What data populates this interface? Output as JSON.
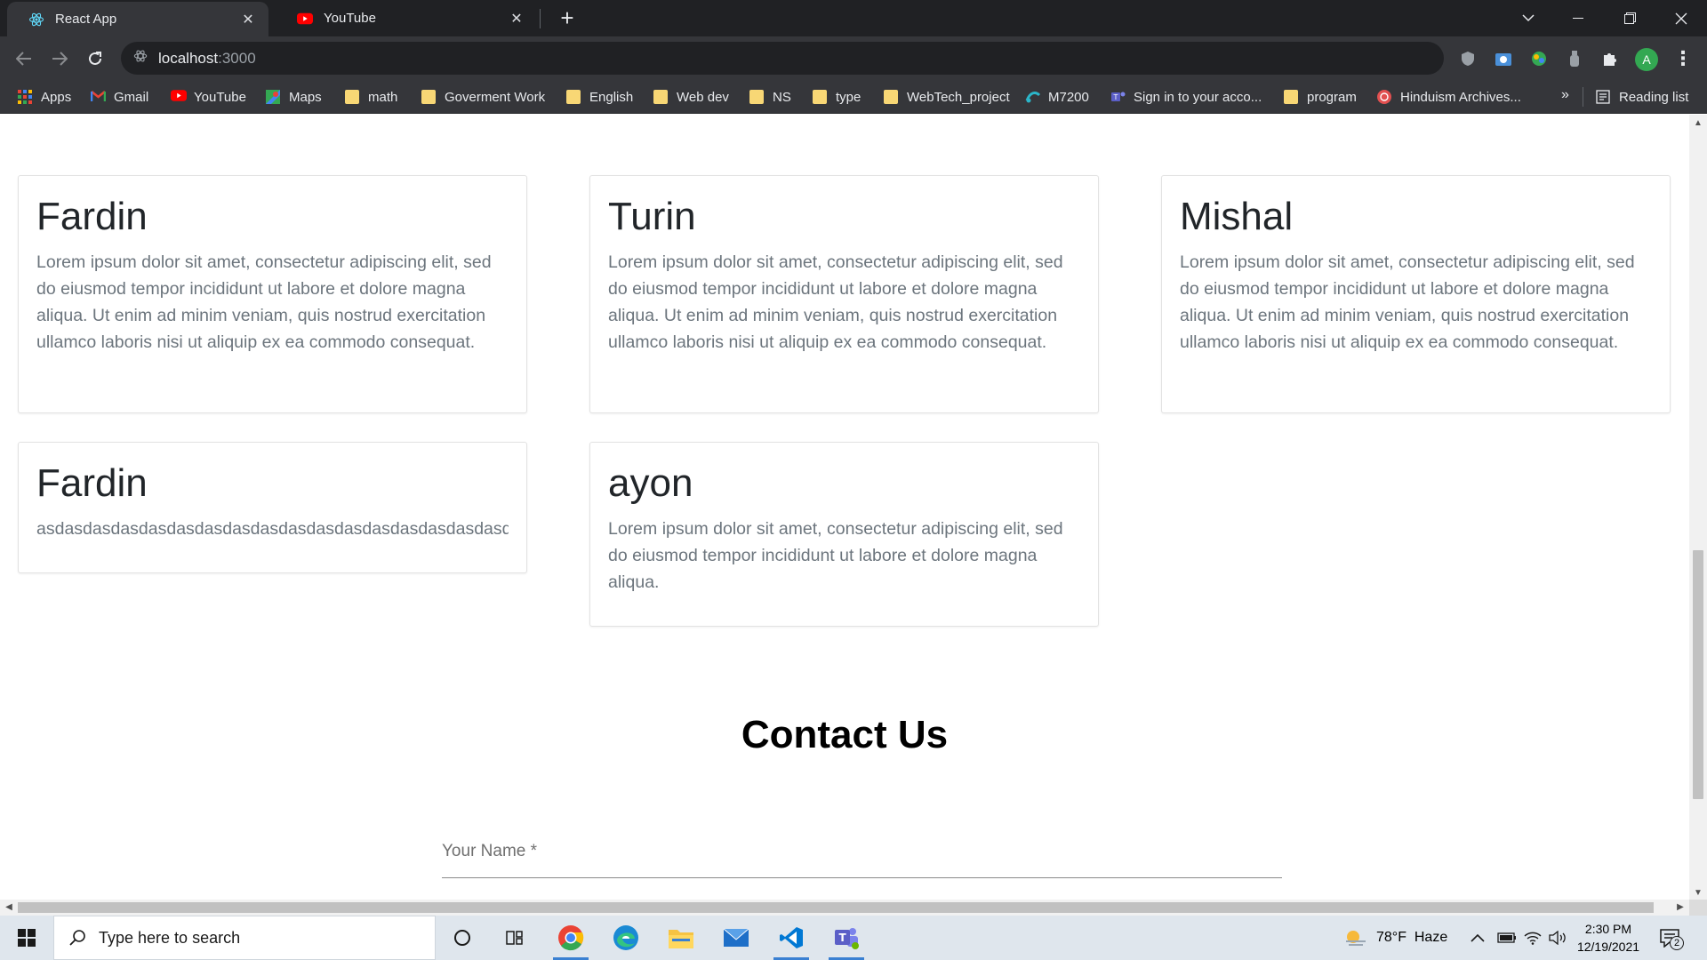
{
  "browser": {
    "tabs": [
      {
        "title": "React App",
        "active": true
      },
      {
        "title": "YouTube",
        "active": false
      }
    ],
    "url_host": "localhost",
    "url_port": ":3000",
    "profile_initial": "A"
  },
  "bookmarks": {
    "items": [
      {
        "label": "Apps",
        "icon": "apps-grid-icon"
      },
      {
        "label": "Gmail",
        "icon": "gmail-icon"
      },
      {
        "label": "YouTube",
        "icon": "youtube-icon"
      },
      {
        "label": "Maps",
        "icon": "maps-icon"
      },
      {
        "label": "math",
        "icon": "folder-icon"
      },
      {
        "label": "Goverment Work",
        "icon": "folder-icon"
      },
      {
        "label": "English",
        "icon": "folder-icon"
      },
      {
        "label": "Web dev",
        "icon": "folder-icon"
      },
      {
        "label": "NS",
        "icon": "folder-icon"
      },
      {
        "label": "type",
        "icon": "folder-icon"
      },
      {
        "label": "WebTech_project",
        "icon": "folder-icon"
      },
      {
        "label": "M7200",
        "icon": "m7200-icon"
      },
      {
        "label": "Sign in to your acco...",
        "icon": "teams-icon"
      },
      {
        "label": "program",
        "icon": "folder-icon"
      },
      {
        "label": "Hinduism Archives...",
        "icon": "hinduism-icon"
      }
    ],
    "more": "»",
    "reading_list": "Reading list"
  },
  "page": {
    "cards": [
      {
        "name": "Fardin",
        "text": "Lorem ipsum dolor sit amet, consectetur adipiscing elit, sed do eiusmod tempor incididunt ut labore et dolore magna aliqua. Ut enim ad minim veniam, quis nostrud exercitation ullamco laboris nisi ut aliquip ex ea commodo consequat."
      },
      {
        "name": "Turin",
        "text": "Lorem ipsum dolor sit amet, consectetur adipiscing elit, sed do eiusmod tempor incididunt ut labore et dolore magna aliqua. Ut enim ad minim veniam, quis nostrud exercitation ullamco laboris nisi ut aliquip ex ea commodo consequat."
      },
      {
        "name": "Mishal",
        "text": "Lorem ipsum dolor sit amet, consectetur adipiscing elit, sed do eiusmod tempor incididunt ut labore et dolore magna aliqua. Ut enim ad minim veniam, quis nostrud exercitation ullamco laboris nisi ut aliquip ex ea commodo consequat."
      },
      {
        "name": "Fardin",
        "text": "asdasdasdasdasdasdasdasdasdasdasdasdasdasdasdasdasdas"
      },
      {
        "name": "ayon",
        "text": "Lorem ipsum dolor sit amet, consectetur adipiscing elit, sed do eiusmod tempor incididunt ut labore et dolore magna aliqua."
      }
    ],
    "contact_title": "Contact Us",
    "name_field_label": "Your Name *"
  },
  "taskbar": {
    "search_placeholder": "Type here to search",
    "weather": "78°F  Haze",
    "time": "2:30 PM",
    "date": "12/19/2021",
    "notification_count": "2"
  },
  "colors": {
    "chrome_dark": "#202124",
    "chrome_toolbar": "#35363a",
    "card_text": "#6c757d",
    "taskbar_bg": "#dfe6ed"
  }
}
